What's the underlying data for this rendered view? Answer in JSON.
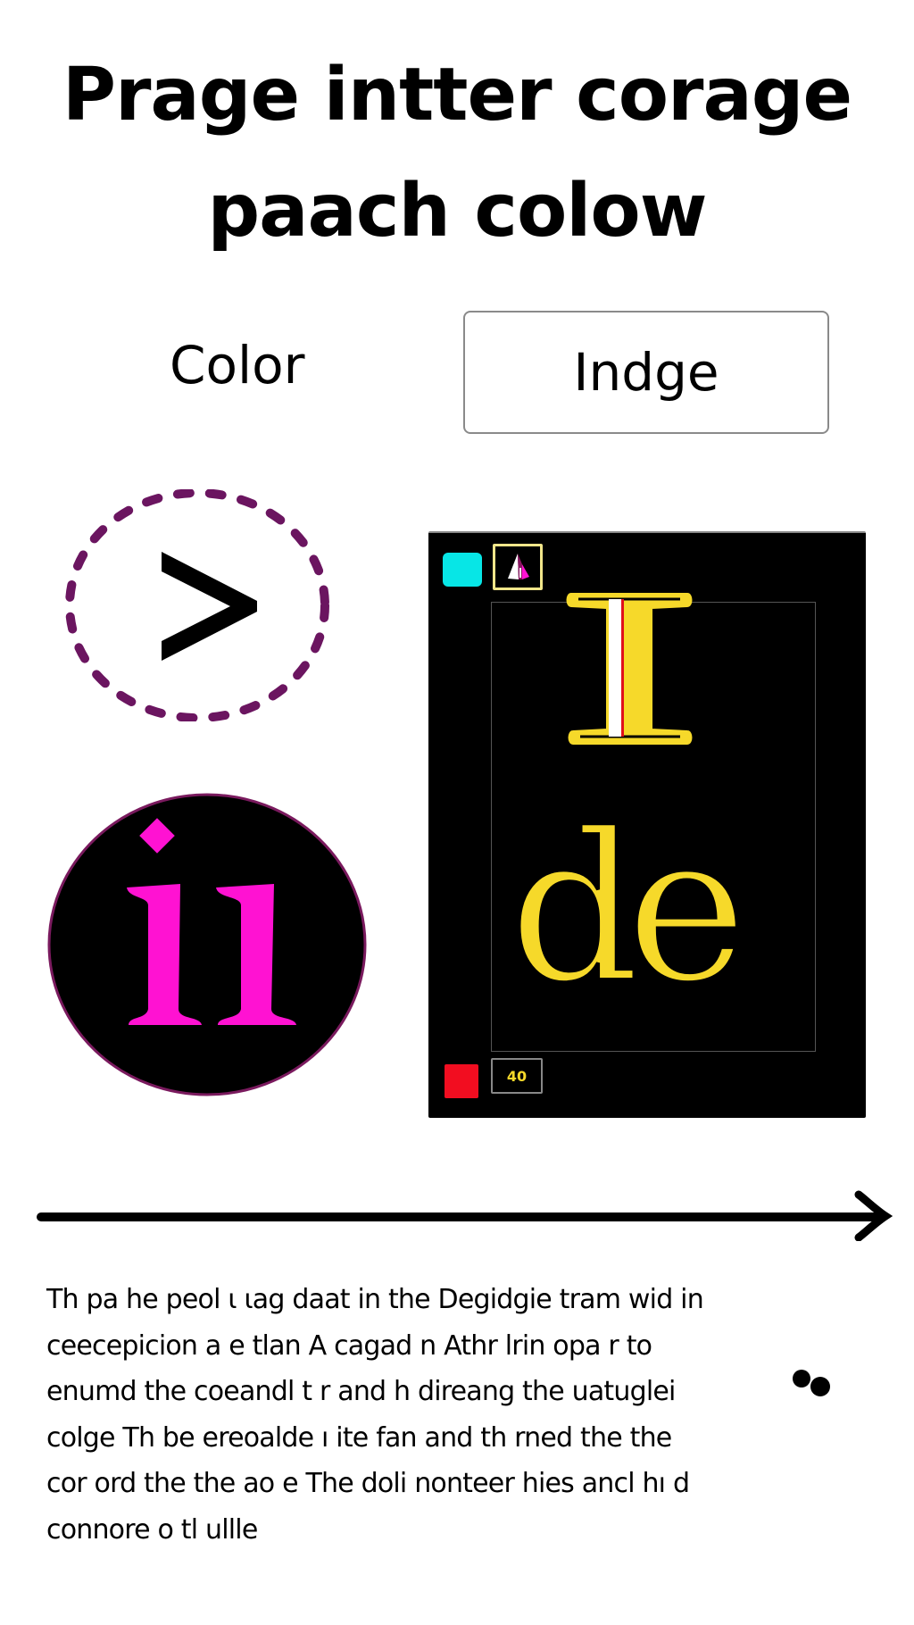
{
  "header": {
    "title_line1": "Prage intter corage",
    "title_line2": "paach colow"
  },
  "controls": {
    "color_label": "Color",
    "indge_button_label": "Indge"
  },
  "icons": {
    "chevron_circle": {
      "icon": "chevron-right-icon",
      "glyph": ">",
      "ring_color": "#6b1560"
    },
    "ii_badge": {
      "icon": "ii-badge-icon",
      "glyph": "ii",
      "glyph_color": "#ff12d2",
      "ring_color": "#7a1a5e"
    }
  },
  "panel": {
    "swatch_top_color": "#07e6e6",
    "swatch_bottom_color": "#f20d20",
    "tool_icon": "triangle-drop-icon",
    "zoom_label": "40",
    "display_text_line1": "I",
    "display_text_line2": "de",
    "text_color": "#f6d92a",
    "cursor_color": "#e0101a"
  },
  "arrow": {
    "icon": "long-arrow-right-icon"
  },
  "body_text": {
    "lines": [
      "Th   pa   he peol ι ιag     daat    in the Degidgie tram wid in",
      "ceecepicion a   e tlan  A cagad n    Athr  lrin    opa   r to",
      "enumd the coeandl t   r and   h    direang the uatuglei",
      "colge Th    be ereoalde      ı ite    fan and th     rned the the",
      "cor  ord the the   ao e  The doli       nonteer   hies ancl hı  d",
      "connore    o tl    ullle"
    ]
  }
}
